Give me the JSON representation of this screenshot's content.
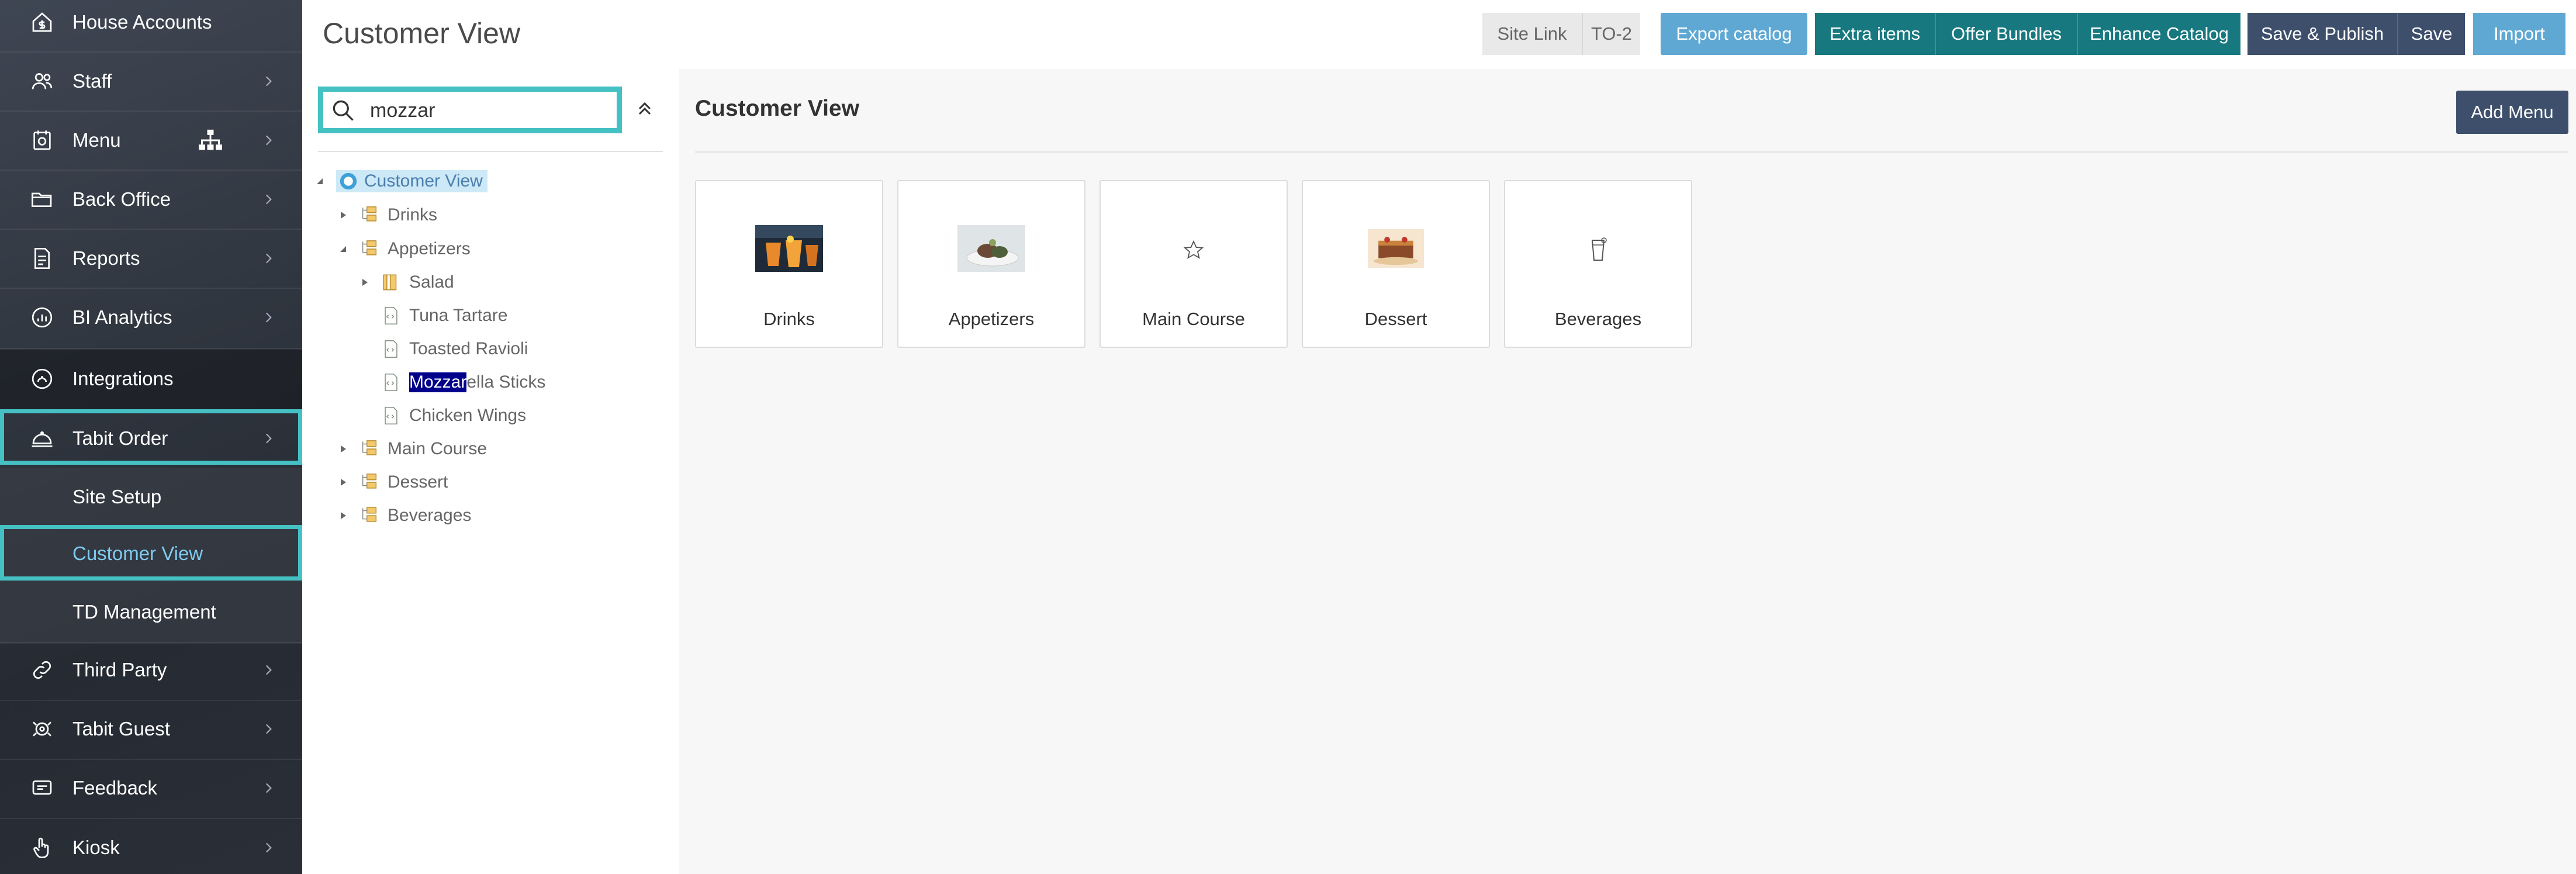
{
  "sidebar": {
    "items": [
      {
        "label": "House Accounts",
        "icon": "house-dollar-icon"
      },
      {
        "label": "Staff",
        "icon": "users-icon"
      },
      {
        "label": "Menu",
        "icon": "menu-book-icon"
      },
      {
        "label": "Back Office",
        "icon": "folder-icon"
      },
      {
        "label": "Reports",
        "icon": "report-icon"
      },
      {
        "label": "BI Analytics",
        "icon": "analytics-icon"
      },
      {
        "label": "Integrations",
        "icon": "integrations-icon"
      },
      {
        "label": "Tabit Order",
        "icon": "cloche-icon"
      },
      {
        "label": "Site Setup"
      },
      {
        "label": "Customer View"
      },
      {
        "label": "TD Management"
      },
      {
        "label": "Third Party",
        "icon": "link-icon"
      },
      {
        "label": "Tabit Guest",
        "icon": "guest-icon"
      },
      {
        "label": "Feedback",
        "icon": "feedback-icon"
      },
      {
        "label": "Kiosk",
        "icon": "hand-pointer-icon"
      }
    ]
  },
  "header": {
    "title": "Customer View",
    "buttons": {
      "site_link": "Site Link",
      "to2": "TO-2",
      "export_catalog": "Export catalog",
      "extra_items": "Extra items",
      "offer_bundles": "Offer Bundles",
      "enhance_catalog": "Enhance Catalog",
      "save_publish": "Save & Publish",
      "save": "Save",
      "import": "Import"
    }
  },
  "tree": {
    "search_value": "mozzar",
    "root": "Customer View",
    "nodes": {
      "drinks": "Drinks",
      "appetizers": "Appetizers",
      "salad": "Salad",
      "tuna_tartare": "Tuna Tartare",
      "toasted_ravioli": "Toasted Ravioli",
      "mozzarella_match": "Mozzar",
      "mozzarella_rest": "ella Sticks",
      "chicken_wings": "Chicken Wings",
      "main_course": "Main Course",
      "dessert": "Dessert",
      "beverages": "Beverages"
    }
  },
  "main": {
    "title": "Customer View",
    "add_menu": "Add Menu",
    "cards": [
      {
        "label": "Drinks",
        "icon": "drinks-photo"
      },
      {
        "label": "Appetizers",
        "icon": "appetizers-photo"
      },
      {
        "label": "Main Course",
        "icon": "star-icon"
      },
      {
        "label": "Dessert",
        "icon": "dessert-photo"
      },
      {
        "label": "Beverages",
        "icon": "cup-icon"
      }
    ]
  },
  "colors": {
    "teal_highlight": "#45c1c4",
    "light_blue_btn": "#5fa8d3",
    "teal_btn": "#17787f",
    "navy_btn": "#3d4f6b",
    "selection_bg": "#00008b"
  }
}
